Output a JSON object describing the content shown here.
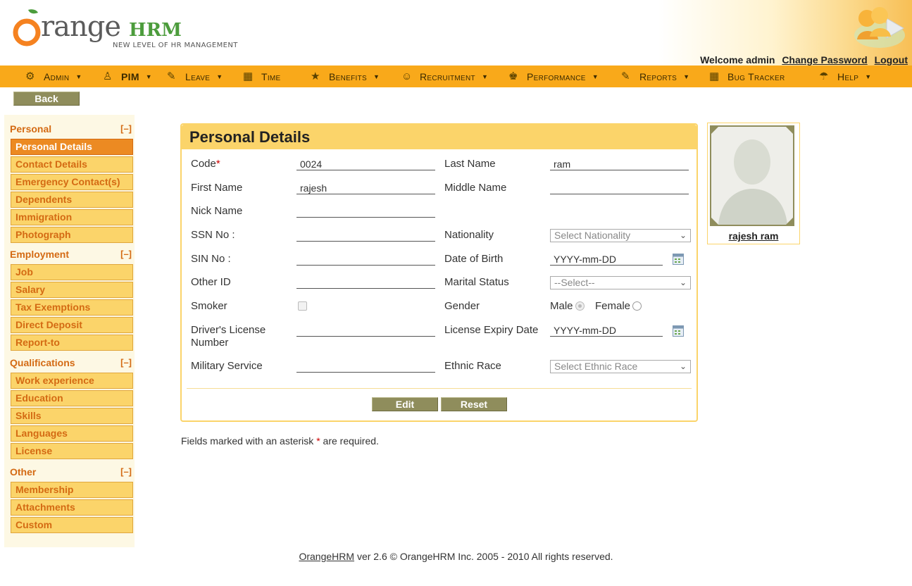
{
  "header": {
    "logo_word": "range",
    "logo_hrm": "HRM",
    "tagline": "NEW LEVEL OF HR MANAGEMENT",
    "welcome": "Welcome admin",
    "change_password": "Change Password",
    "logout": "Logout"
  },
  "menu": [
    {
      "label": "Admin",
      "icon": "admin-icon",
      "caret": true
    },
    {
      "label": "PIM",
      "icon": "pim-icon",
      "caret": true,
      "active": true
    },
    {
      "label": "Leave",
      "icon": "leave-icon",
      "caret": true
    },
    {
      "label": "Time",
      "icon": "time-icon",
      "caret": false
    },
    {
      "label": "Benefits",
      "icon": "benefits-icon",
      "caret": true
    },
    {
      "label": "Recruitment",
      "icon": "recruitment-icon",
      "caret": true
    },
    {
      "label": "Performance",
      "icon": "performance-icon",
      "caret": true
    },
    {
      "label": "Reports",
      "icon": "reports-icon",
      "caret": true
    },
    {
      "label": "Bug Tracker",
      "icon": "bug-tracker-icon",
      "caret": false
    },
    {
      "label": "Help",
      "icon": "help-icon",
      "caret": true
    }
  ],
  "back_label": "Back",
  "sidebar": {
    "collapse_label": "[–]",
    "sections": [
      {
        "title": "Personal",
        "items": [
          "Personal Details",
          "Contact Details",
          "Emergency Contact(s)",
          "Dependents",
          "Immigration",
          "Photograph"
        ]
      },
      {
        "title": "Employment",
        "items": [
          "Job",
          "Salary",
          "Tax Exemptions",
          "Direct Deposit",
          "Report-to"
        ]
      },
      {
        "title": "Qualifications",
        "items": [
          "Work experience",
          "Education",
          "Skills",
          "Languages",
          "License"
        ]
      },
      {
        "title": "Other",
        "items": [
          "Membership",
          "Attachments",
          "Custom"
        ]
      }
    ],
    "active_item": "Personal Details"
  },
  "panel": {
    "title": "Personal Details",
    "fields": {
      "code": {
        "label": "Code",
        "value": "0024",
        "required": "*"
      },
      "last_name": {
        "label": "Last Name",
        "value": "ram"
      },
      "first_name": {
        "label": "First Name",
        "value": "rajesh"
      },
      "middle_name": {
        "label": "Middle Name",
        "value": ""
      },
      "nick_name": {
        "label": "Nick Name",
        "value": ""
      },
      "ssn": {
        "label": "SSN No :",
        "value": ""
      },
      "nationality": {
        "label": "Nationality",
        "value": "Select Nationality"
      },
      "sin": {
        "label": "SIN No :",
        "value": ""
      },
      "dob": {
        "label": "Date of Birth",
        "value": "YYYY-mm-DD"
      },
      "other_id": {
        "label": "Other ID",
        "value": ""
      },
      "marital_status": {
        "label": "Marital Status",
        "value": "--Select--"
      },
      "smoker": {
        "label": "Smoker",
        "checked": false
      },
      "gender": {
        "label": "Gender",
        "male": "Male",
        "female": "Female",
        "selected": "Male"
      },
      "drivers_license": {
        "label_line1": "Driver's License",
        "label_line2": "Number",
        "value": ""
      },
      "license_expiry": {
        "label": "License Expiry Date",
        "value": "YYYY-mm-DD"
      },
      "military": {
        "label": "Military Service",
        "value": ""
      },
      "ethnic_race": {
        "label": "Ethnic Race",
        "value": "Select Ethnic Race"
      }
    },
    "edit_label": "Edit",
    "reset_label": "Reset"
  },
  "required_note": {
    "before": "Fields marked with an asterisk",
    "star": "*",
    "after": "are required."
  },
  "photo": {
    "name": "rajesh ram"
  },
  "footer": {
    "link": "OrangeHRM",
    "text": "ver 2.6 © OrangeHRM Inc. 2005 - 2010 All rights reserved."
  },
  "colors": {
    "menu_bar": "#f9a91a",
    "sidebar_item": "#fbd46a",
    "sidebar_active": "#ec8a22",
    "button": "#8f8d5c",
    "accent_text": "#d46a13"
  }
}
